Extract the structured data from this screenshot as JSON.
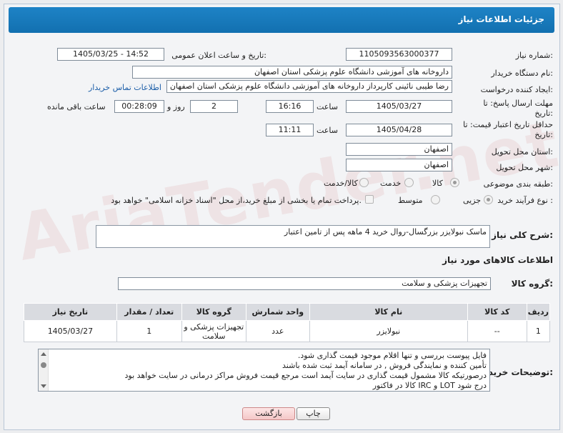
{
  "header": {
    "title": "جزئیات اطلاعات نیاز"
  },
  "labels": {
    "need_number": "شماره نیاز:",
    "announce_datetime": "تاریخ و ساعت اعلان عمومی:",
    "buyer_org": "نام دستگاه خریدار:",
    "requester": "ایجاد کننده درخواست:",
    "deadline": "مهلت ارسال پاسخ: تا تاریخ:",
    "price_validity": "حداقل تاریخ اعتبار قیمت: تا تاریخ:",
    "province": "استان محل تحویل:",
    "city": "شهر محل تحویل:",
    "category": "طبقه بندی موضوعی:",
    "process_type": "نوع فرآیند خرید :",
    "time": "ساعت",
    "day_and": "روز و",
    "remaining": "ساعت باقی مانده",
    "contact_link": "اطلاعات تماس خریدار"
  },
  "values": {
    "need_number": "1105093563000377",
    "announce_datetime": "1405/03/25 - 14:52",
    "buyer_org": "داروخانه های آموزشی دانشگاه علوم پزشکی استان اصفهان",
    "requester": "رضا طیبی نائینی کارپرداز داروخانه های آموزشی دانشگاه علوم پزشکی استان اصفهان",
    "deadline_date": "1405/03/27",
    "deadline_time": "16:16",
    "days": "2",
    "remaining_time": "00:28:09",
    "validity_date": "1405/04/28",
    "validity_time": "11:11",
    "province": "اصفهان",
    "city": "اصفهان"
  },
  "category_options": [
    "کالا",
    "خدمت",
    "کالا/خدمت"
  ],
  "process_options": [
    "جزیی",
    "متوسط"
  ],
  "payment_note": "پرداخت تمام یا بخشی از مبلغ خرید،از محل \"اسناد خزانه اسلامی\" خواهد بود.",
  "description": {
    "label": "شرح کلی نیاز:",
    "text": "ماسک نبولایزر بزرگسال-روال خرید 4 ماهه پس از تامین اعتبار"
  },
  "goods_section": {
    "title": "اطلاعات کالاهای مورد نیاز",
    "group_label": "گروه کالا:",
    "group_value": "تجهیزات پزشکی و سلامت"
  },
  "table": {
    "headers": [
      "ردیف",
      "کد کالا",
      "نام کالا",
      "واحد شمارش",
      "گروه کالا",
      "تعداد / مقدار",
      "تاریخ نیاز"
    ],
    "rows": [
      [
        "1",
        "--",
        "نبولایزر",
        "عدد",
        "تجهیزات پزشکی و سلامت",
        "1",
        "1405/03/27"
      ]
    ]
  },
  "buyer_notes": {
    "label": "توضیحات خریدار:",
    "lines": [
      "فایل پیوست بررسی و تنها اقلام موجود قیمت گذاری شود.",
      "تأمین کننده و نمایندگی فروش , در سامانه آیمد ثبت شده باشند",
      "درصورتیکه کالا مشمول قیمت گذاری در سایت آیمد است مرجع قیمت فروش مراکز درمانی در سایت خواهد بود",
      "درج شود LOT و IRC کالا در فاکتور"
    ]
  },
  "buttons": {
    "print": "چاپ",
    "back": "بازگشت"
  },
  "watermark": "AriaTender.net"
}
